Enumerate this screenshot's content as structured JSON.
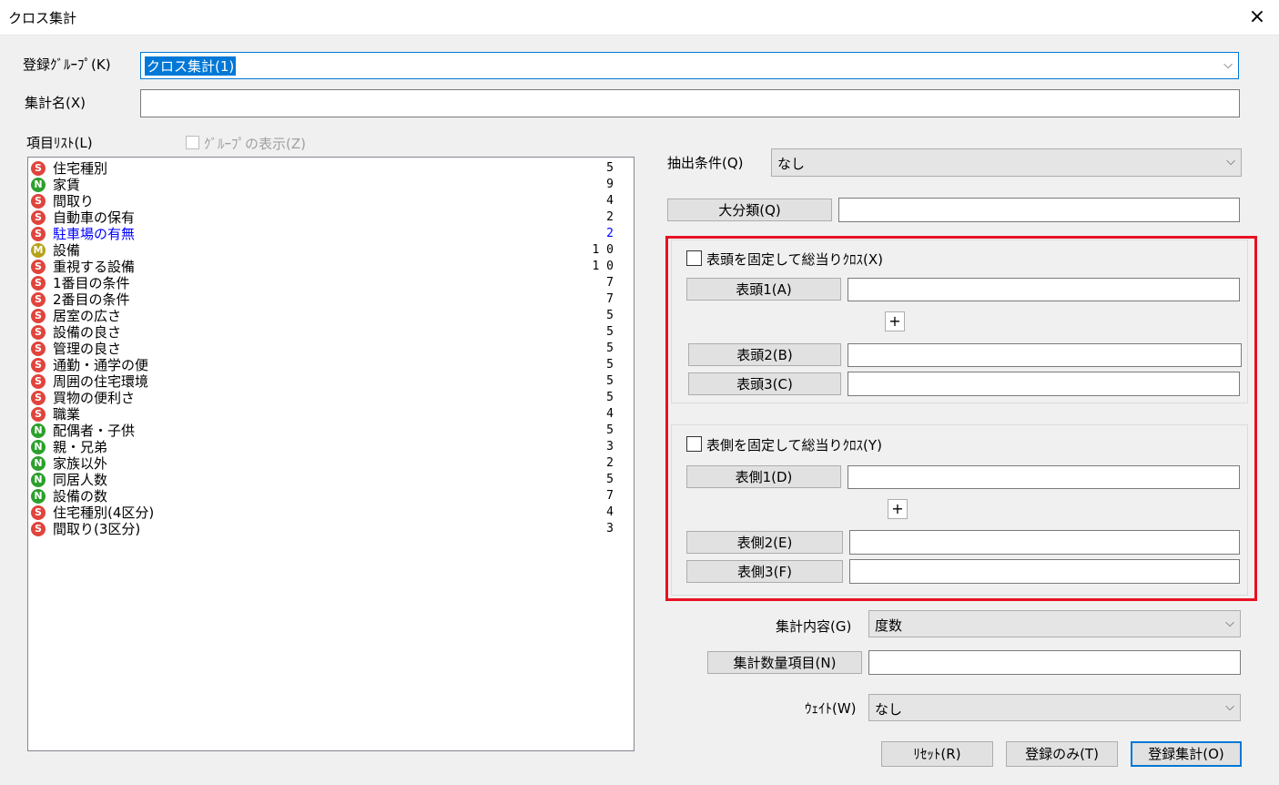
{
  "window": {
    "title": "クロス集計",
    "close_icon": "×"
  },
  "group": {
    "label": "登録ｸﾞﾙｰﾌﾟ(K)",
    "value": "クロス集計(1)"
  },
  "name": {
    "label": "集計名(X)",
    "value": ""
  },
  "item_list": {
    "label": "項目ﾘｽﾄ(L)",
    "group_display_label": "ｸﾞﾙｰﾌﾟの表示(Z)",
    "items": [
      {
        "type": "S",
        "name": "住宅種別",
        "count": "5"
      },
      {
        "type": "N",
        "name": "家賃",
        "count": "9"
      },
      {
        "type": "S",
        "name": "間取り",
        "count": "4"
      },
      {
        "type": "S",
        "name": "自動車の保有",
        "count": "2"
      },
      {
        "type": "S",
        "name": "駐車場の有無",
        "count": "2"
      },
      {
        "type": "M",
        "name": "設備",
        "count": "1 0"
      },
      {
        "type": "S",
        "name": "重視する設備",
        "count": "1 0"
      },
      {
        "type": "S",
        "name": "1番目の条件",
        "count": "7"
      },
      {
        "type": "S",
        "name": "2番目の条件",
        "count": "7"
      },
      {
        "type": "S",
        "name": "居室の広さ",
        "count": "5"
      },
      {
        "type": "S",
        "name": "設備の良さ",
        "count": "5"
      },
      {
        "type": "S",
        "name": "管理の良さ",
        "count": "5"
      },
      {
        "type": "S",
        "name": "通勤・通学の便",
        "count": "5"
      },
      {
        "type": "S",
        "name": "周囲の住宅環境",
        "count": "5"
      },
      {
        "type": "S",
        "name": "買物の便利さ",
        "count": "5"
      },
      {
        "type": "S",
        "name": "職業",
        "count": "4"
      },
      {
        "type": "N",
        "name": "配偶者・子供",
        "count": "5"
      },
      {
        "type": "N",
        "name": "親・兄弟",
        "count": "3"
      },
      {
        "type": "N",
        "name": "家族以外",
        "count": "2"
      },
      {
        "type": "N",
        "name": "同居人数",
        "count": "5"
      },
      {
        "type": "N",
        "name": "設備の数",
        "count": "7"
      },
      {
        "type": "S",
        "name": "住宅種別(4区分)",
        "count": "4"
      },
      {
        "type": "S",
        "name": "間取り(3区分)",
        "count": "3"
      }
    ]
  },
  "extract": {
    "label": "抽出条件(Q)",
    "value": "なし"
  },
  "major": {
    "button": "大分類(Q)",
    "value": ""
  },
  "header": {
    "fix_label": "表頭を固定して総当りｸﾛｽ(X)",
    "b1": "表頭1(A)",
    "b2": "表頭2(B)",
    "b3": "表頭3(C)",
    "plus": "+"
  },
  "side": {
    "fix_label": "表側を固定して総当りｸﾛｽ(Y)",
    "b1": "表側1(D)",
    "b2": "表側2(E)",
    "b3": "表側3(F)",
    "plus": "+"
  },
  "content": {
    "label": "集計内容(G)",
    "value": "度数"
  },
  "quantity": {
    "button": "集計数量項目(N)",
    "value": ""
  },
  "weight": {
    "label": "ｳｪｲﾄ(W)",
    "value": "なし"
  },
  "buttons": {
    "reset": "ﾘｾｯﾄ(R)",
    "register_only": "登録のみ(T)",
    "register_tabulate": "登録集計(O)"
  },
  "colors": {
    "S": "#e0443c",
    "N": "#2ca02c",
    "M": "#b5a21a",
    "selected": "#0000ff",
    "highlight": "#e81123"
  },
  "chevron_icon": "⌵"
}
